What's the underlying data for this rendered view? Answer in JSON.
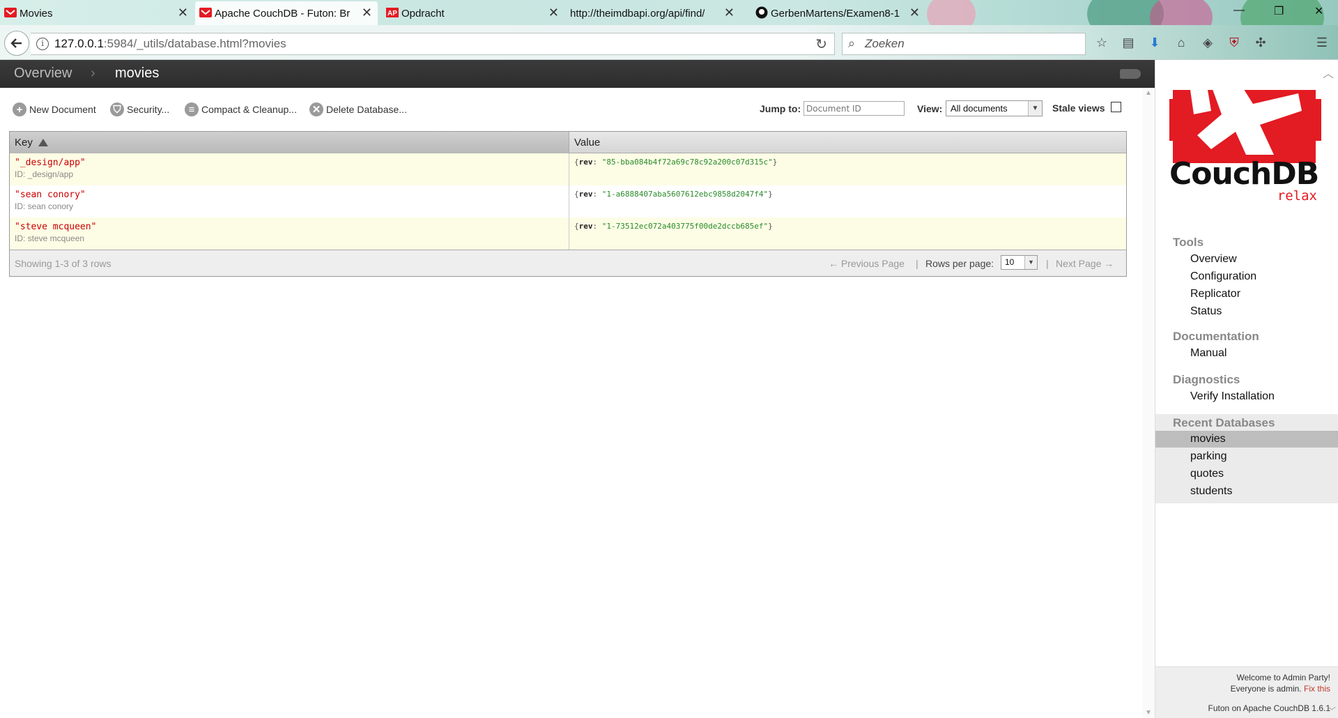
{
  "browser": {
    "tabs": [
      {
        "title": "Movies",
        "active": false
      },
      {
        "title": "Apache CouchDB - Futon: Br",
        "active": true
      },
      {
        "title": "Opdracht",
        "active": false
      },
      {
        "title": "http://theimdbapi.org/api/find/",
        "active": false
      },
      {
        "title": "GerbenMartens/Examen8-1",
        "active": false
      }
    ],
    "url_host": "127.0.0.1",
    "url_path": ":5984/_utils/database.html?movies",
    "search_placeholder": "Zoeken"
  },
  "breadcrumb": {
    "root": "Overview",
    "separator": "›",
    "current": "movies"
  },
  "toolbar": {
    "new_document": "New Document",
    "security": "Security...",
    "compact": "Compact & Cleanup...",
    "delete": "Delete Database...",
    "jump_label": "Jump to:",
    "jump_placeholder": "Document ID",
    "view_label": "View:",
    "view_selected": "All documents",
    "stale_label": "Stale views"
  },
  "table": {
    "col_key": "Key",
    "col_value": "Value",
    "rows": [
      {
        "key": "\"_design/app\"",
        "id": "ID: _design/app",
        "rev_label": "rev",
        "rev": "\"85-bba084b4f72a69c78c92a200c07d315c\""
      },
      {
        "key": "\"sean conory\"",
        "id": "ID: sean conory",
        "rev_label": "rev",
        "rev": "\"1-a6888407aba5607612ebc9858d2047f4\""
      },
      {
        "key": "\"steve mcqueen\"",
        "id": "ID: steve mcqueen",
        "rev_label": "rev",
        "rev": "\"1-73512ec072a403775f00de2dccb685ef\""
      }
    ],
    "showing": "Showing 1-3 of 3 rows",
    "prev_page": "← Previous Page",
    "rows_per_page_label": "Rows per page:",
    "rows_per_page": "10",
    "next_page": "Next Page →"
  },
  "sidebar": {
    "logo_text": "CouchDB",
    "logo_tagline": "relax",
    "tools_head": "Tools",
    "tools": [
      "Overview",
      "Configuration",
      "Replicator",
      "Status"
    ],
    "docs_head": "Documentation",
    "docs": [
      "Manual"
    ],
    "diag_head": "Diagnostics",
    "diag": [
      "Verify Installation"
    ],
    "recent_head": "Recent Databases",
    "recent": [
      "movies",
      "parking",
      "quotes",
      "students"
    ],
    "recent_selected": "movies",
    "welcome": "Welcome to Admin Party!",
    "everyone": "Everyone is admin.",
    "fix": "Fix this",
    "version": "Futon on Apache CouchDB 1.6.1"
  },
  "colors": {
    "header_bg": "#2d2d2d",
    "key_red": "#cc0000",
    "rev_green": "#2a8a2a",
    "logo_red": "#e31b23"
  }
}
